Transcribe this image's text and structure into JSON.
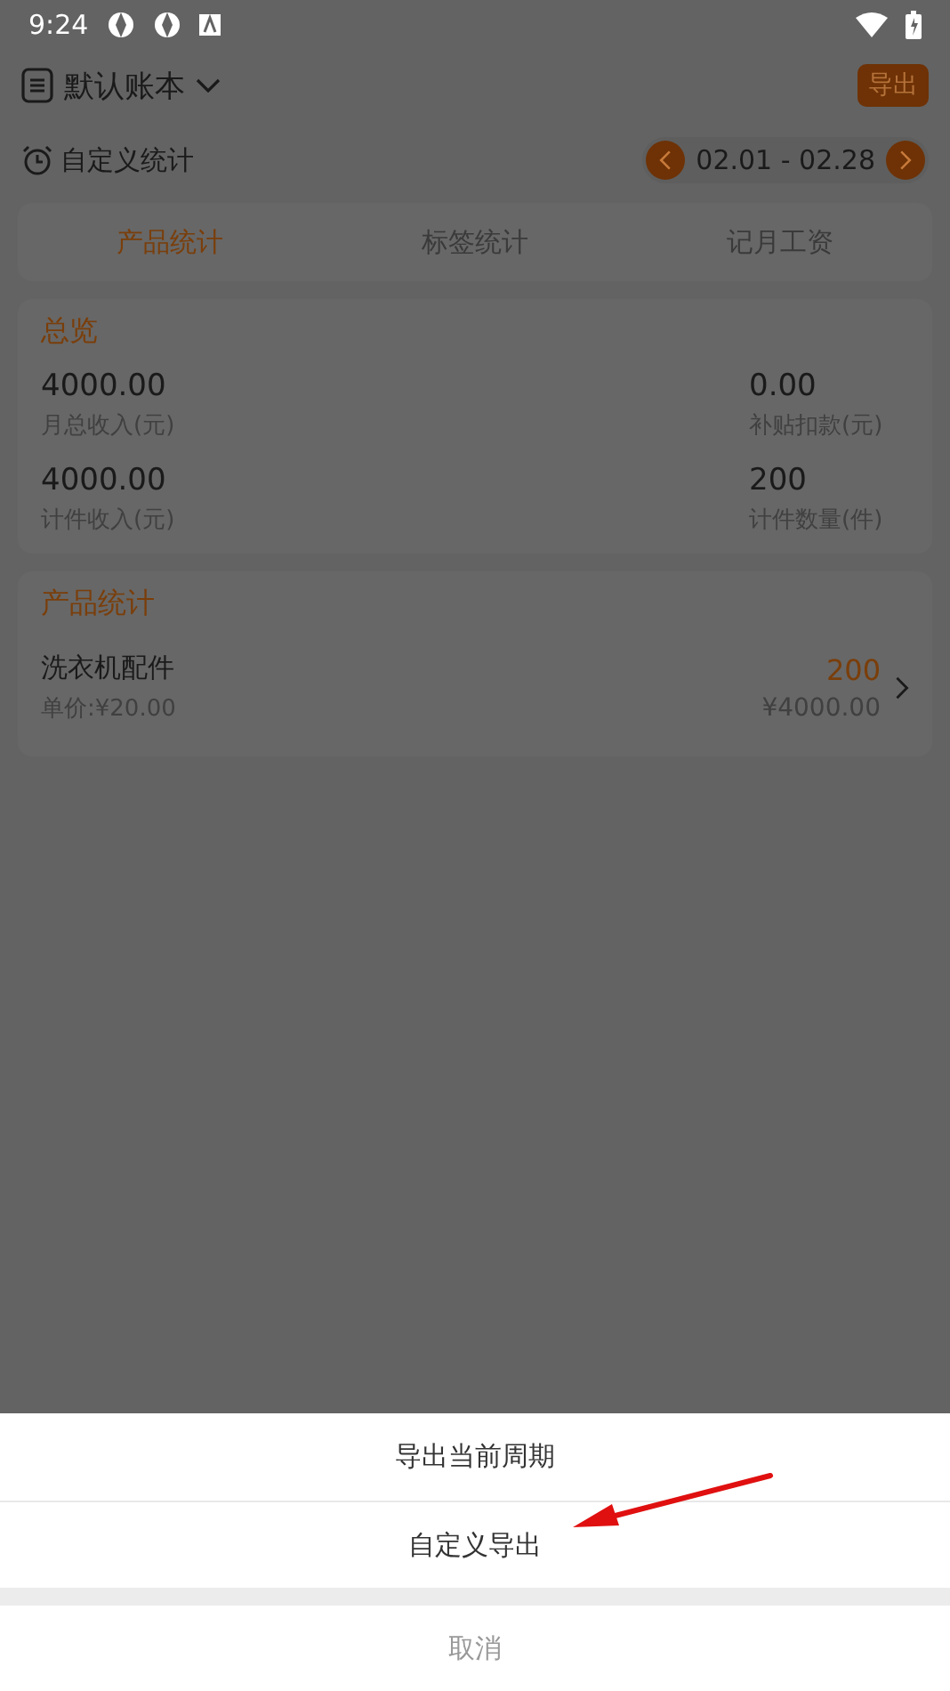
{
  "status_bar": {
    "time": "9:24"
  },
  "header": {
    "book_title": "默认账本",
    "export_button": "导出"
  },
  "period": {
    "label": "自定义统计",
    "range": "02.01 - 02.28"
  },
  "tabs": [
    {
      "label": "产品统计",
      "selected": true
    },
    {
      "label": "标签统计",
      "selected": false
    },
    {
      "label": "记月工资",
      "selected": false
    }
  ],
  "overview": {
    "title": "总览",
    "stats": [
      {
        "value": "4000.00",
        "label": "月总收入(元)"
      },
      {
        "value": "0.00",
        "label": "补贴扣款(元)"
      },
      {
        "value": "4000.00",
        "label": "计件收入(元)"
      },
      {
        "value": "200",
        "label": "计件数量(件)"
      }
    ]
  },
  "products": {
    "title": "产品统计",
    "items": [
      {
        "name": "洗衣机配件",
        "unit_price": "单价:¥20.00",
        "count": "200",
        "amount": "¥4000.00"
      }
    ]
  },
  "sheet": {
    "options": [
      "导出当前周期",
      "自定义导出"
    ],
    "cancel": "取消"
  }
}
